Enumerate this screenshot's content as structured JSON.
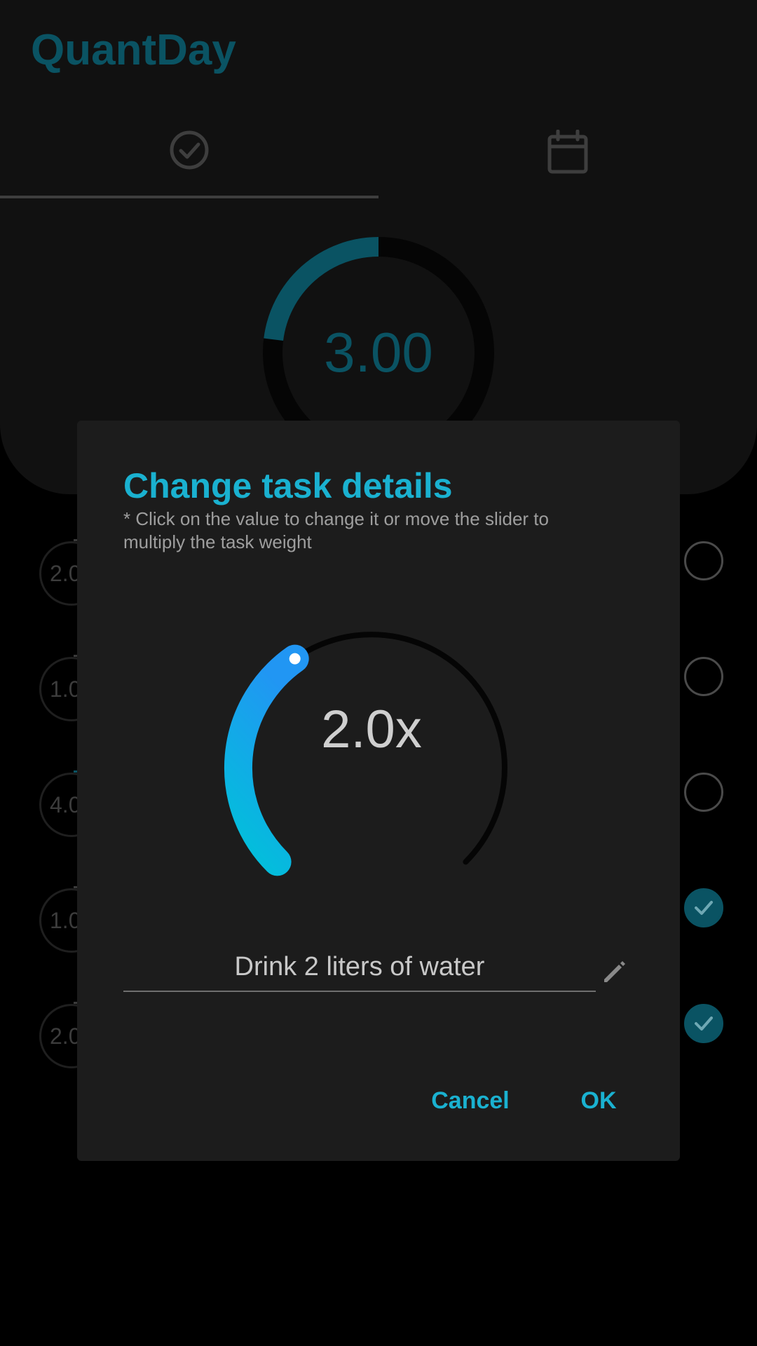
{
  "app": {
    "title": "QuantDay",
    "tabs": [
      {
        "icon": "check-circle-icon",
        "active": true
      },
      {
        "icon": "calendar-icon",
        "active": false
      }
    ],
    "progress": {
      "value": "3.00",
      "fill_fraction": 0.23,
      "color": "#0a5363"
    },
    "tasks": [
      {
        "weight": "2.0",
        "done": false
      },
      {
        "weight": "1.0",
        "done": false
      },
      {
        "weight": "4.0",
        "done": false
      },
      {
        "weight": "1.0",
        "done": true
      },
      {
        "weight": "2.0",
        "done": true
      }
    ]
  },
  "dialog": {
    "title": "Change task details",
    "hint": "* Click on the value to change it or move the slider to multiply the task weight",
    "multiplier": {
      "value": "2.0x",
      "fill_fraction": 0.37,
      "accent": "#1ab1d0"
    },
    "task_name": "Drink 2 liters of water",
    "cancel_label": "Cancel",
    "ok_label": "OK"
  },
  "colors": {
    "accent": "#1ab1d0",
    "dark_teal": "#0a5363",
    "dialog_bg": "#1c1c1c",
    "screen_bg": "#000000"
  }
}
